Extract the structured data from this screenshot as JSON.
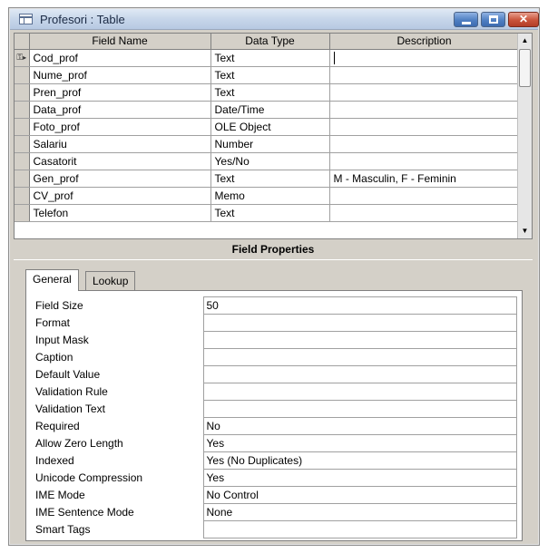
{
  "window": {
    "title": "Profesori : Table"
  },
  "grid": {
    "headers": [
      "Field Name",
      "Data Type",
      "Description"
    ],
    "rows": [
      {
        "name": "Cod_prof",
        "type": "Text",
        "description": ""
      },
      {
        "name": "Nume_prof",
        "type": "Text",
        "description": ""
      },
      {
        "name": "Pren_prof",
        "type": "Text",
        "description": ""
      },
      {
        "name": "Data_prof",
        "type": "Date/Time",
        "description": ""
      },
      {
        "name": "Foto_prof",
        "type": "OLE Object",
        "description": ""
      },
      {
        "name": "Salariu",
        "type": "Number",
        "description": ""
      },
      {
        "name": "Casatorit",
        "type": "Yes/No",
        "description": ""
      },
      {
        "name": "Gen_prof",
        "type": "Text",
        "description": "M - Masculin, F - Feminin"
      },
      {
        "name": "CV_prof",
        "type": "Memo",
        "description": ""
      },
      {
        "name": "Telefon",
        "type": "Text",
        "description": ""
      }
    ],
    "selected_row_icons": "key-icon, row-pointer-icon"
  },
  "field_properties": {
    "heading": "Field Properties",
    "tabs": [
      "General",
      "Lookup"
    ],
    "active_tab": "General",
    "properties": [
      {
        "name": "Field Size",
        "value": "50"
      },
      {
        "name": "Format",
        "value": ""
      },
      {
        "name": "Input Mask",
        "value": ""
      },
      {
        "name": "Caption",
        "value": ""
      },
      {
        "name": "Default Value",
        "value": ""
      },
      {
        "name": "Validation Rule",
        "value": ""
      },
      {
        "name": "Validation Text",
        "value": ""
      },
      {
        "name": "Required",
        "value": "No"
      },
      {
        "name": "Allow Zero Length",
        "value": "Yes"
      },
      {
        "name": "Indexed",
        "value": "Yes (No Duplicates)"
      },
      {
        "name": "Unicode Compression",
        "value": "Yes"
      },
      {
        "name": "IME Mode",
        "value": "No Control"
      },
      {
        "name": "IME Sentence Mode",
        "value": "None"
      },
      {
        "name": "Smart Tags",
        "value": ""
      }
    ]
  }
}
